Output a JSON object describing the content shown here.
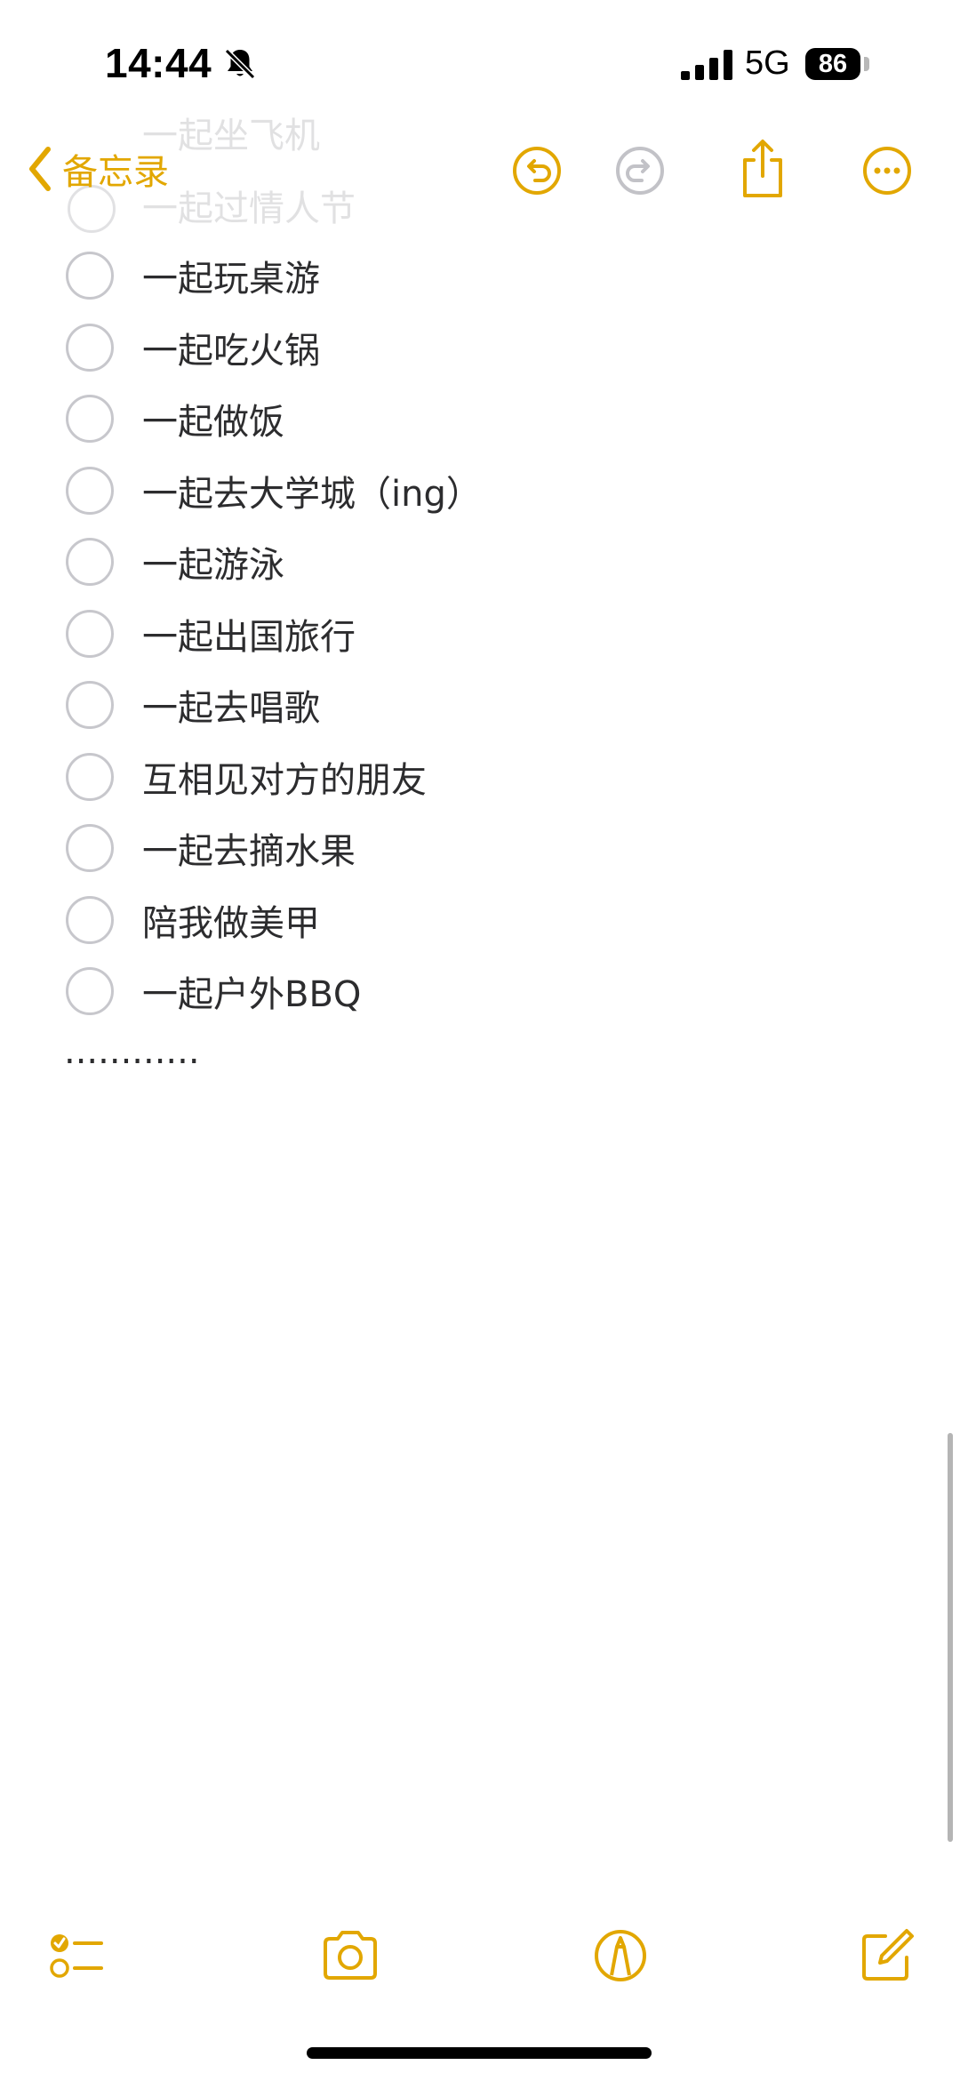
{
  "status_bar": {
    "time": "14:44",
    "network": "5G",
    "battery": "86",
    "icons": [
      "bell-slash-icon",
      "signal-icon",
      "battery-icon"
    ]
  },
  "nav": {
    "back_label": "备忘录",
    "icons": [
      "chevron-left-icon",
      "undo-icon",
      "redo-icon",
      "share-icon",
      "more-icon"
    ]
  },
  "ghost_items": [
    "一起坐飞机",
    "一起过情人节"
  ],
  "checklist": [
    "一起玩桌游",
    "一起吃火锅",
    "一起做饭",
    "一起去大学城（ing）",
    "一起游泳",
    "一起出国旅行",
    "一起去唱歌",
    "互相见对方的朋友",
    "一起去摘水果",
    "陪我做美甲",
    "一起户外BBQ"
  ],
  "trailing_text": "............",
  "toolbar": {
    "icons": [
      "checklist-icon",
      "camera-icon",
      "markup-icon",
      "compose-icon"
    ]
  },
  "colors": {
    "accent": "#E2A700",
    "text": "#2C2C2E",
    "circle": "#C7C7CC"
  }
}
